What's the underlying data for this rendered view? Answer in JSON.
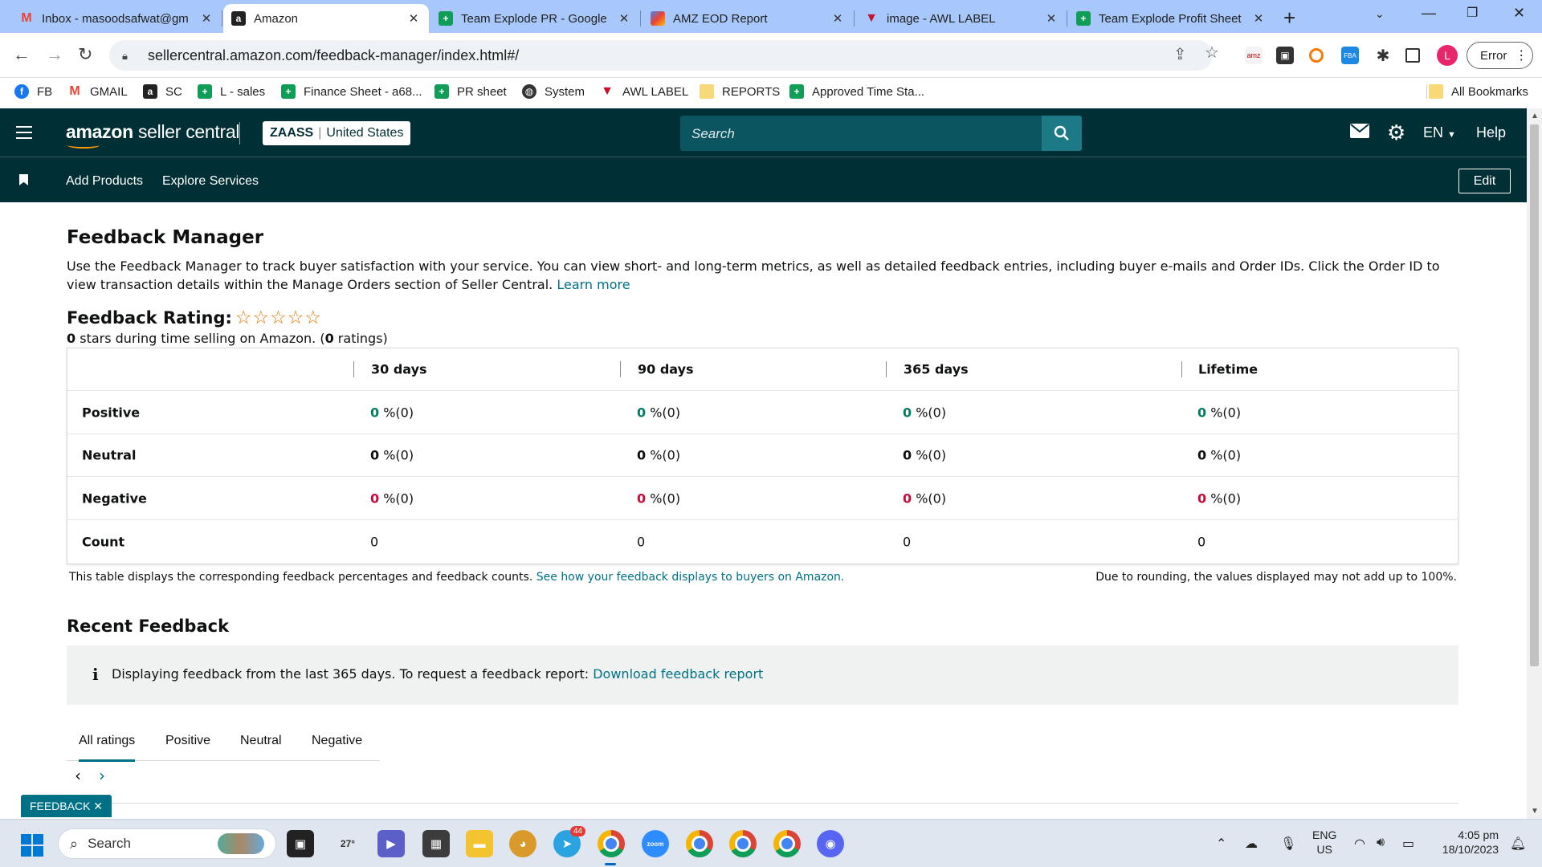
{
  "browser": {
    "tabs": [
      {
        "title": "Inbox - masoodsafwat@gm",
        "icon": "gmail-icon",
        "active": false
      },
      {
        "title": "Amazon",
        "icon": "amazon-icon",
        "active": true
      },
      {
        "title": "Team Explode PR - Google",
        "icon": "sheets-icon",
        "active": false
      },
      {
        "title": "AMZ EOD Report",
        "icon": "report-icon",
        "active": false
      },
      {
        "title": "image - AWL LABEL",
        "icon": "awl-icon",
        "active": false
      },
      {
        "title": "Team Explode Profit Sheet",
        "icon": "sheets-icon",
        "active": false
      }
    ],
    "url": "sellercentral.amazon.com/feedback-manager/index.html#/",
    "error_label": "Error",
    "profile_initial": "L",
    "bookmarks": [
      {
        "label": "FB",
        "icon": "facebook-icon"
      },
      {
        "label": "GMAIL",
        "icon": "gmail-icon"
      },
      {
        "label": "SC",
        "icon": "amazon-icon"
      },
      {
        "label": "L - sales",
        "icon": "sheets-icon"
      },
      {
        "label": "Finance Sheet - a68...",
        "icon": "sheets-icon"
      },
      {
        "label": "PR sheet",
        "icon": "sheets-icon"
      },
      {
        "label": "System",
        "icon": "globe-icon"
      },
      {
        "label": "AWL LABEL",
        "icon": "awl-icon"
      },
      {
        "label": "REPORTS",
        "icon": "folder-icon"
      },
      {
        "label": "Approved Time Sta...",
        "icon": "sheets-icon"
      }
    ],
    "all_bookmarks": "All Bookmarks"
  },
  "header": {
    "logo_brand": "amazon",
    "logo_product": "seller central",
    "store_name": "ZAASS",
    "store_region": "United States",
    "search_placeholder": "Search",
    "language": "EN",
    "help": "Help",
    "subnav": [
      "Add Products",
      "Explore Services"
    ],
    "edit": "Edit"
  },
  "page": {
    "title": "Feedback Manager",
    "intro": "Use the Feedback Manager to track buyer satisfaction with your service. You can view short- and long-term metrics, as well as detailed feedback entries, including buyer e-mails and Order IDs. Click the Order ID to view transaction details within the Manage Orders section of Seller Central.",
    "learn_more": "Learn more",
    "rating_title": "Feedback Rating:",
    "star_count": 0,
    "stars_display": "☆☆☆☆☆",
    "rating_stars_value": "0",
    "rating_sub_mid": " stars during time selling on Amazon. (",
    "rating_count": "0",
    "rating_sub_end": " ratings)",
    "table": {
      "columns": [
        "30 days",
        "90 days",
        "365 days",
        "Lifetime"
      ],
      "rows": [
        {
          "label": "Positive",
          "cells": [
            {
              "v": "0",
              "rest": " %(0)"
            },
            {
              "v": "0",
              "rest": " %(0)"
            },
            {
              "v": "0",
              "rest": " %(0)"
            },
            {
              "v": "0",
              "rest": " %(0)"
            }
          ]
        },
        {
          "label": "Neutral",
          "cells": [
            {
              "v": "0",
              "rest": " %(0)"
            },
            {
              "v": "0",
              "rest": " %(0)"
            },
            {
              "v": "0",
              "rest": " %(0)"
            },
            {
              "v": "0",
              "rest": " %(0)"
            }
          ]
        },
        {
          "label": "Negative",
          "cells": [
            {
              "v": "0",
              "rest": " %(0)"
            },
            {
              "v": "0",
              "rest": " %(0)"
            },
            {
              "v": "0",
              "rest": " %(0)"
            },
            {
              "v": "0",
              "rest": " %(0)"
            }
          ]
        },
        {
          "label": "Count",
          "cells": [
            "0",
            "0",
            "0",
            "0"
          ]
        }
      ]
    },
    "note_left": "This table displays the corresponding feedback percentages and feedback counts.",
    "note_link": "See how your feedback displays to buyers on Amazon.",
    "note_right": "Due to rounding, the values displayed may not add up to 100%.",
    "recent_title": "Recent Feedback",
    "info_icon": "i",
    "info_text": "Displaying feedback from the last 365 days. To request a feedback report:",
    "info_link": "Download feedback report",
    "filter_tabs": [
      "All ratings",
      "Positive",
      "Neutral",
      "Negative"
    ],
    "active_filter": "All ratings",
    "feedback_pill": "FEEDBACK ✕"
  },
  "taskbar": {
    "search_label": "Search",
    "weather": "27°",
    "telegram_badge": "44",
    "lang_top": "ENG",
    "lang_bottom": "US",
    "time": "4:05 pm",
    "date": "18/10/2023"
  },
  "colors": {
    "header_bg": "#002f36",
    "positive": "#067d62",
    "negative": "#cc0c39",
    "link": "#007185",
    "star": "#e77600"
  }
}
